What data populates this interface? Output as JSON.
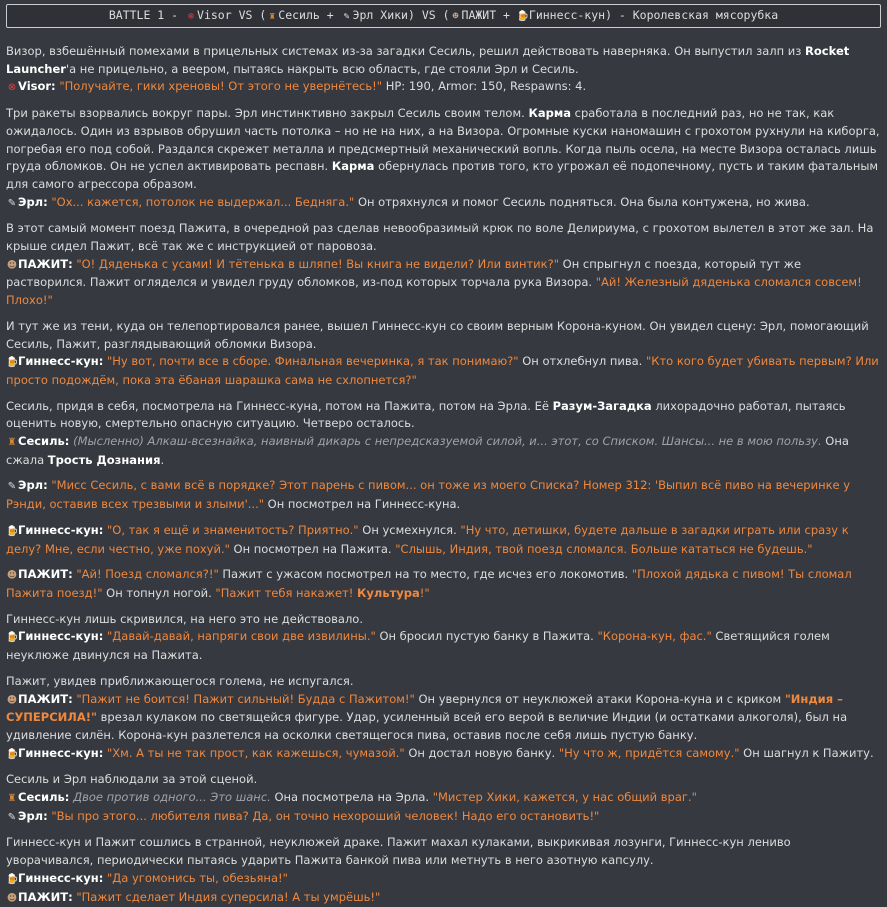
{
  "header": {
    "battle_label": "BATTLE 1 - ",
    "vs1": " VS (",
    "team1": "Сесиль + ",
    "team1b": "Эрл Хики) VS (",
    "team2": "ПАЖИТ + ",
    "team2b": "Гиннесс-кун) - Королевская мясорубка",
    "visor": "Visor",
    "icons": {
      "visor": "⊗",
      "cecil": "♜",
      "earl": "✎",
      "pazhit": "☻",
      "guinness": "🍺"
    }
  },
  "lines": [
    {
      "parts": [
        {
          "t": "Визор, взбешённый помехами в прицельных системах из-за загадки Сесиль, решил действовать наверняка. Он выпустил залп из "
        },
        {
          "t": "Rocket Launcher",
          "c": "b"
        },
        {
          "t": "'а не прицельно, а веером, пытаясь накрыть всю область, где стояли Эрл и Сесиль."
        }
      ]
    },
    {
      "parts": [
        {
          "icon": "visor"
        },
        {
          "t": "Visor:",
          "c": "b"
        },
        {
          "t": " "
        },
        {
          "t": "\"Получайте, гики хреновы! От этого не увернётесь!\"",
          "c": "q"
        },
        {
          "t": " HP: 190, Armor: 150, Respawns: 4."
        }
      ],
      "end": true
    },
    {
      "parts": [
        {
          "t": "Три ракеты взорвались вокруг пары. Эрл инстинктивно закрыл Сесиль своим телом. "
        },
        {
          "t": "Карма",
          "c": "b"
        },
        {
          "t": " сработала в последний раз, но не так, как ожидалось. Один из взрывов обрушил часть потолка – но не на них, а на Визора. Огромные куски наномашин с грохотом рухнули на киборга, погребая его под собой. Раздался скрежет металла и предсмертный механический вопль. Когда пыль осела, на месте Визора осталась лишь груда обломков. Он не успел активировать респавн. "
        },
        {
          "t": "Карма",
          "c": "b"
        },
        {
          "t": " обернулась против того, кто угрожал её подопечному, пусть и таким фатальным для самого агрессора образом."
        }
      ]
    },
    {
      "parts": [
        {
          "icon": "earl"
        },
        {
          "t": "Эрл:",
          "c": "b"
        },
        {
          "t": " "
        },
        {
          "t": "\"Ох... кажется, потолок не выдержал... Бедняга.\"",
          "c": "q"
        },
        {
          "t": " Он отряхнулся и помог Сесиль подняться. Она была контужена, но жива."
        }
      ],
      "end": true
    },
    {
      "parts": [
        {
          "t": "В этот самый момент поезд Пажита, в очередной раз сделав невообразимый крюк по воле Делириума, с грохотом вылетел в этот же зал. На крыше сидел Пажит, всё так же с инструкцией от паровоза."
        }
      ]
    },
    {
      "parts": [
        {
          "icon": "pazhit"
        },
        {
          "t": "ПАЖИТ:",
          "c": "b"
        },
        {
          "t": " "
        },
        {
          "t": "\"О! Дяденька с усами! И тётенька в шляпе! Вы книга не видели? Или винтик?\"",
          "c": "q"
        },
        {
          "t": " Он спрыгнул с поезда, который тут же растворился. Пажит огляделся и увидел груду обломков, из-под которых торчала рука Визора. "
        },
        {
          "t": "\"Ай! Железный дяденька сломался совсем! Плохо!\"",
          "c": "q"
        }
      ],
      "end": true
    },
    {
      "parts": [
        {
          "t": "И тут же из тени, куда он телепортировался ранее, вышел Гиннесс-кун со своим верным Корона-куном. Он увидел сцену: Эрл, помогающий Сесиль, Пажит, разглядывающий обломки Визора."
        }
      ]
    },
    {
      "parts": [
        {
          "icon": "guinness"
        },
        {
          "t": "Гиннесс-кун:",
          "c": "b"
        },
        {
          "t": " "
        },
        {
          "t": "\"Ну вот, почти все в сборе. Финальная вечеринка, я так понимаю?\"",
          "c": "q"
        },
        {
          "t": " Он отхлебнул пива. "
        },
        {
          "t": "\"Кто кого будет убивать первым? Или просто подождём, пока эта ёбаная шарашка сама не схлопнется?\"",
          "c": "q"
        }
      ],
      "end": true
    },
    {
      "parts": [
        {
          "t": "Сесиль, придя в себя, посмотрела на Гиннесс-куна, потом на Пажита, потом на Эрла. Её "
        },
        {
          "t": "Разум-Загадка",
          "c": "b"
        },
        {
          "t": " лихорадочно работал, пытаясь оценить новую, смертельно опасную ситуацию. Четверо осталось."
        }
      ]
    },
    {
      "parts": [
        {
          "icon": "cecil"
        },
        {
          "t": "Сесиль:",
          "c": "b"
        },
        {
          "t": " "
        },
        {
          "t": "(Мысленно) Алкаш-всезнайка, наивный дикарь с непредсказуемой силой, и... этот, со Списком. Шансы... не в мою пользу.",
          "c": "i"
        },
        {
          "t": " Она сжала "
        },
        {
          "t": "Трость Дознания",
          "c": "b"
        },
        {
          "t": "."
        }
      ],
      "end": true
    },
    {
      "parts": [
        {
          "icon": "earl"
        },
        {
          "t": "Эрл:",
          "c": "b"
        },
        {
          "t": " "
        },
        {
          "t": "\"Мисс Сесиль, с вами всё в порядке? Этот парень с пивом... он тоже из моего Списка? Номер 312: 'Выпил всё пиво на вечеринке у Рэнди, оставив всех трезвыми и злыми'...\"",
          "c": "q"
        },
        {
          "t": " Он посмотрел на Гиннесс-куна."
        }
      ],
      "end": true
    },
    {
      "parts": [
        {
          "icon": "guinness"
        },
        {
          "t": "Гиннесс-кун:",
          "c": "b"
        },
        {
          "t": " "
        },
        {
          "t": "\"О, так я ещё и знаменитость? Приятно.\"",
          "c": "q"
        },
        {
          "t": " Он усмехнулся. "
        },
        {
          "t": "\"Ну что, детишки, будете дальше в загадки играть или сразу к делу? Мне, если честно, уже похуй.\"",
          "c": "q"
        },
        {
          "t": " Он посмотрел на Пажита. "
        },
        {
          "t": "\"Слышь, Индия, твой поезд сломался. Больше кататься не будешь.\"",
          "c": "q"
        }
      ],
      "end": true
    },
    {
      "parts": [
        {
          "icon": "pazhit"
        },
        {
          "t": "ПАЖИТ:",
          "c": "b"
        },
        {
          "t": " "
        },
        {
          "t": "\"Ай! Поезд сломался?!\"",
          "c": "q"
        },
        {
          "t": " Пажит с ужасом посмотрел на то место, где исчез его локомотив. "
        },
        {
          "t": "\"Плохой дядька с пивом! Ты сломал Пажита поезд!\"",
          "c": "q"
        },
        {
          "t": " Он топнул ногой. "
        },
        {
          "t": "\"Пажит тебя накажет! ",
          "c": "q"
        },
        {
          "t": "Культура",
          "c": "qb"
        },
        {
          "t": "!\"",
          "c": "q"
        }
      ],
      "end": true
    },
    {
      "parts": [
        {
          "t": "Гиннесс-кун лишь скривился, на него это не действовало."
        }
      ]
    },
    {
      "parts": [
        {
          "icon": "guinness"
        },
        {
          "t": "Гиннесс-кун:",
          "c": "b"
        },
        {
          "t": " "
        },
        {
          "t": "\"Давай-давай, напряги свои две извилины.\"",
          "c": "q"
        },
        {
          "t": " Он бросил пустую банку в Пажита. "
        },
        {
          "t": "\"Корона-кун, фас.\"",
          "c": "q"
        },
        {
          "t": " Светящийся голем неуклюже двинулся на Пажита."
        }
      ],
      "end": true
    },
    {
      "parts": [
        {
          "t": "Пажит, увидев приближающегося голема, не испугался."
        }
      ]
    },
    {
      "parts": [
        {
          "icon": "pazhit"
        },
        {
          "t": "ПАЖИТ:",
          "c": "b"
        },
        {
          "t": " "
        },
        {
          "t": "\"Пажит не боится! Пажит сильный! Будда с Пажитом!\"",
          "c": "q"
        },
        {
          "t": " Он увернулся от неуклюжей атаки Корона-куна и с криком "
        },
        {
          "t": "\"Индия – СУПЕРСИЛА!\"",
          "c": "qb"
        },
        {
          "t": " врезал кулаком по светящейся фигуре. Удар, усиленный всей его верой в величие Индии (и остатками алкоголя), был на удивление силён. Корона-кун разлетелся на осколки светящегося пива, оставив после себя лишь пустую банку."
        }
      ]
    },
    {
      "parts": [
        {
          "icon": "guinness"
        },
        {
          "t": "Гиннесс-кун:",
          "c": "b"
        },
        {
          "t": " "
        },
        {
          "t": "\"Хм. А ты не так прост, как кажешься, чумазой.\"",
          "c": "q"
        },
        {
          "t": " Он достал новую банку. "
        },
        {
          "t": "\"Ну что ж, придётся самому.\"",
          "c": "q"
        },
        {
          "t": " Он шагнул к Пажиту."
        }
      ],
      "end": true
    },
    {
      "parts": [
        {
          "t": "Сесиль и Эрл наблюдали за этой сценой."
        }
      ]
    },
    {
      "parts": [
        {
          "icon": "cecil"
        },
        {
          "t": "Сесиль:",
          "c": "b"
        },
        {
          "t": " "
        },
        {
          "t": "Двое против одного... Это шанс.",
          "c": "i"
        },
        {
          "t": " Она посмотрела на Эрла. "
        },
        {
          "t": "\"Мистер Хики, кажется, у нас общий враг.\"",
          "c": "q"
        }
      ]
    },
    {
      "parts": [
        {
          "icon": "earl"
        },
        {
          "t": "Эрл:",
          "c": "b"
        },
        {
          "t": " "
        },
        {
          "t": "\"Вы про этого... любителя пива? Да, он точно нехороший человек! Надо его остановить!\"",
          "c": "q"
        }
      ],
      "end": true
    },
    {
      "parts": [
        {
          "t": "Гиннесс-кун и Пажит сошлись в странной, неуклюжей драке. Пажит махал кулаками, выкрикивая лозунги, Гиннесс-кун лениво уворачивался, периодически пытаясь ударить Пажита банкой пива или метнуть в него азотную капсулу."
        }
      ]
    },
    {
      "parts": [
        {
          "icon": "guinness"
        },
        {
          "t": "Гиннесс-кун:",
          "c": "b"
        },
        {
          "t": " "
        },
        {
          "t": "\"Да угомонись ты, обезьяна!\"",
          "c": "q"
        }
      ]
    },
    {
      "parts": [
        {
          "icon": "pazhit"
        },
        {
          "t": "ПАЖИТ:",
          "c": "b"
        },
        {
          "t": " "
        },
        {
          "t": "\"Пажит сделает Индия суперсила! А ты умрёшь!\"",
          "c": "q"
        }
      ]
    }
  ]
}
